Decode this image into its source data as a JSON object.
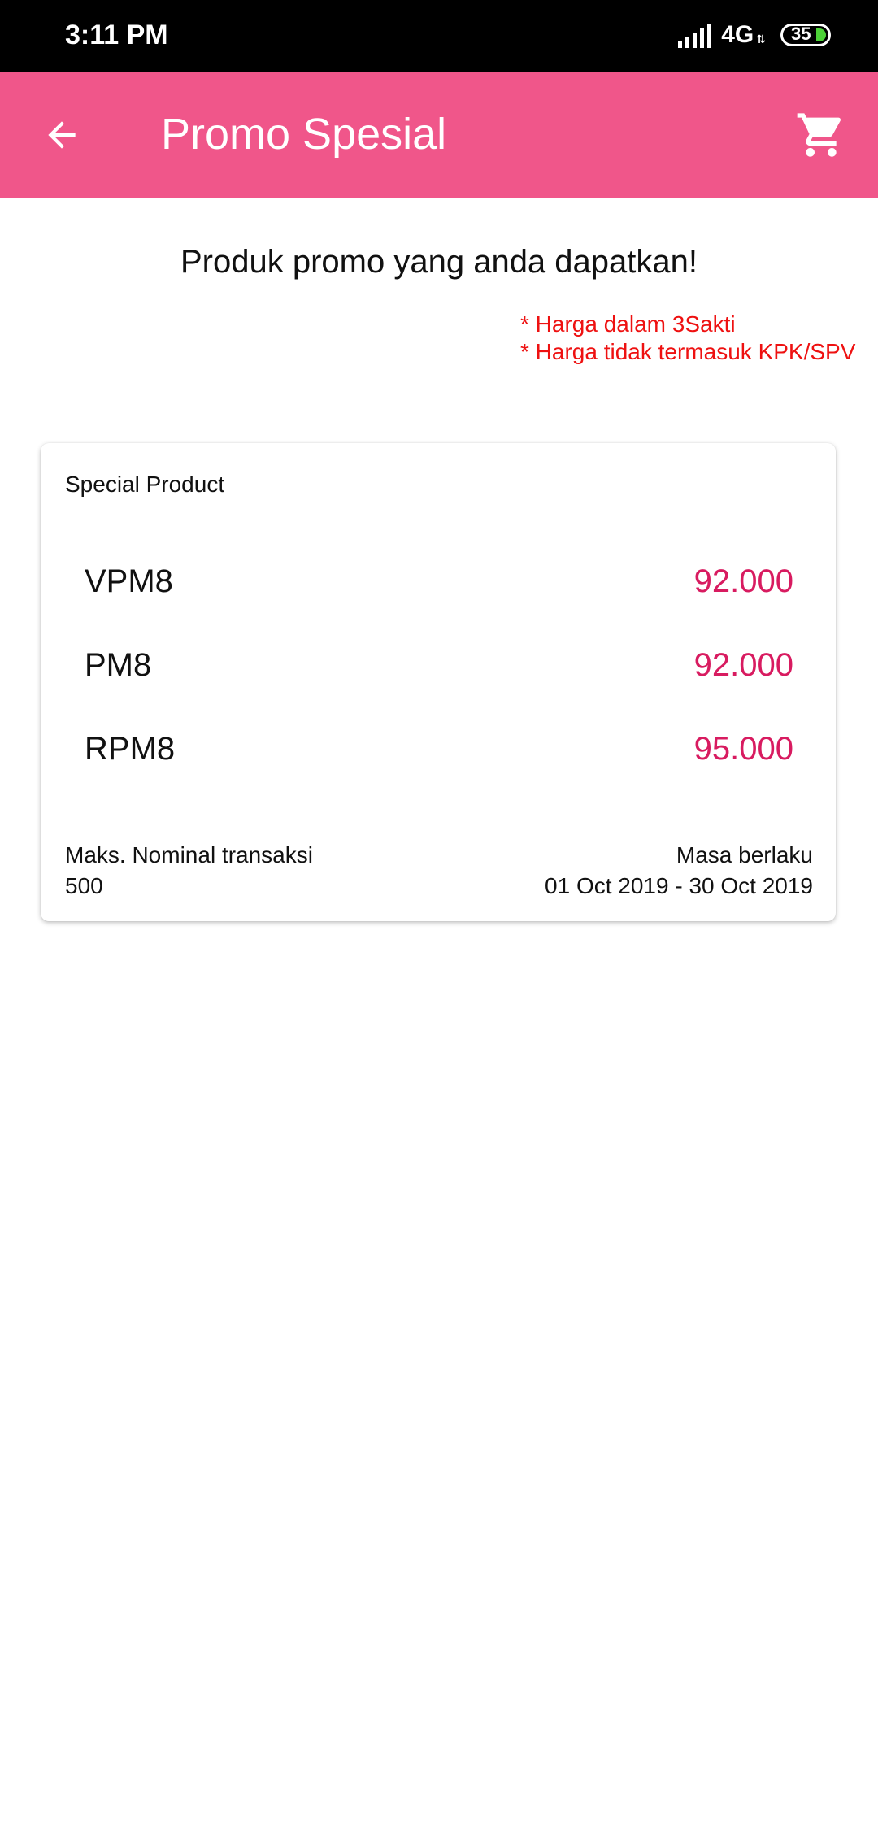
{
  "status_bar": {
    "time": "3:11 PM",
    "network": "4G",
    "battery": "35"
  },
  "app_bar": {
    "title": "Promo Spesial",
    "back_icon": "arrow-back-icon",
    "cart_icon": "shopping-cart-icon",
    "color": "#f0568a"
  },
  "main": {
    "headline": "Produk promo yang anda dapatkan!",
    "notes": [
      "* Harga dalam 3Sakti",
      "* Harga tidak termasuk KPK/SPV"
    ],
    "note_color": "#ee1111"
  },
  "card": {
    "title": "Special Product",
    "products": [
      {
        "name": "VPM8",
        "price": "92.000"
      },
      {
        "name": "PM8",
        "price": "92.000"
      },
      {
        "name": "RPM8",
        "price": "95.000"
      }
    ],
    "price_color": "#d81b60",
    "max_label": "Maks. Nominal transaksi",
    "max_value": "500",
    "validity_label": "Masa berlaku",
    "validity_value": "01 Oct 2019 - 30 Oct 2019"
  }
}
